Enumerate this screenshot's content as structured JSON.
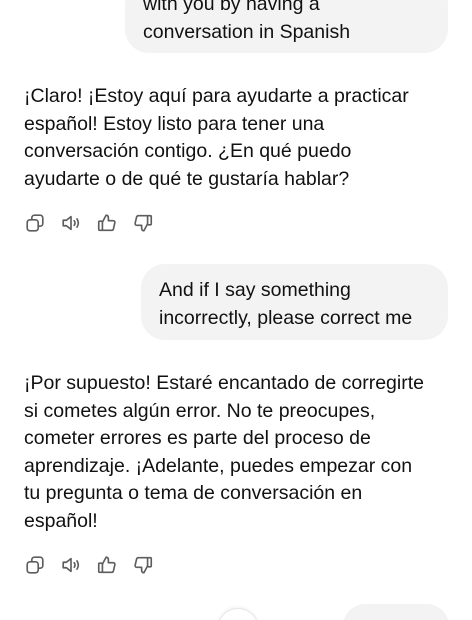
{
  "conversation": {
    "user_messages": [
      {
        "lines": [
          "with you by having a",
          "conversation in Spanish"
        ]
      },
      {
        "lines": [
          "And if I say something",
          "incorrectly, please correct me"
        ]
      }
    ],
    "assistant_messages": [
      {
        "lines": [
          "¡Claro! ¡Estoy aquí para ayudarte a practicar",
          "español! Estoy listo para tener una",
          "conversación contigo. ¿En qué puedo",
          "ayudarte o de qué te gustaría hablar?"
        ]
      },
      {
        "lines": [
          "¡Por supuesto! Estaré encantado de corregirte",
          "si cometes algún error. No te preocupes,",
          "cometer errores es parte del proceso de",
          "aprendizaje. ¡Adelante, puedes empezar con",
          "tu pregunta o tema de conversación en",
          "español!"
        ]
      }
    ]
  },
  "message_actions": [
    "copy-icon",
    "speaker-icon",
    "thumbs-up-icon",
    "thumbs-down-icon"
  ],
  "colors": {
    "user_bubble_bg": "#f3f3f3",
    "text": "#111111",
    "icon": "#5d5d5d",
    "background": "#ffffff"
  }
}
